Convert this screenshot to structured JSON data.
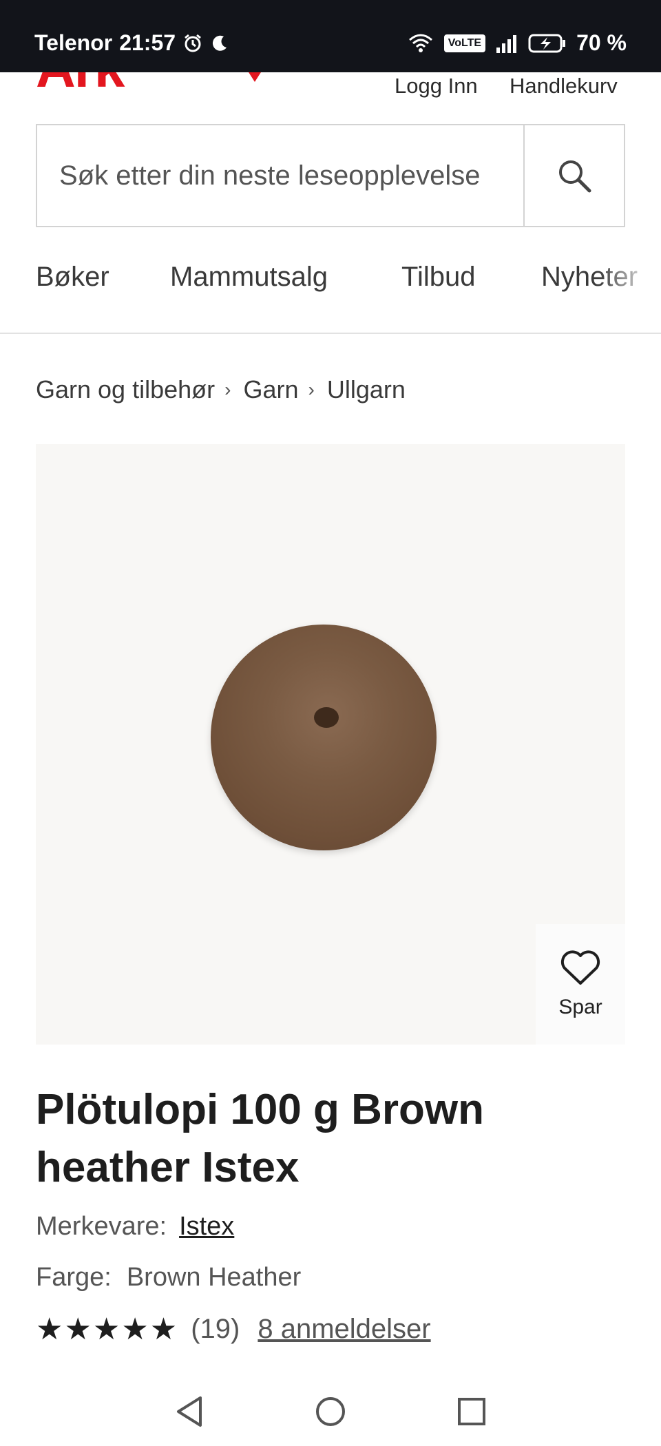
{
  "status_bar": {
    "carrier": "Telenor",
    "time": "21:57",
    "volte": "VoLTE",
    "battery": "70 %",
    "icons": [
      "alarm-icon",
      "moon-icon",
      "wifi-icon",
      "signal-icon",
      "battery-charging-icon"
    ]
  },
  "header": {
    "logo_text": "Ark",
    "login": "Logg Inn",
    "cart": "Handlekurv",
    "brand_color": "#e3161f"
  },
  "search": {
    "placeholder": "Søk etter din neste leseopplevelse",
    "icon": "search-icon"
  },
  "nav": {
    "items": [
      {
        "label": "Bøker"
      },
      {
        "label": "Mammutsalg"
      },
      {
        "label": "Tilbud"
      },
      {
        "label": "Nyheter"
      }
    ]
  },
  "breadcrumb": {
    "items": [
      "Garn og tilbehør",
      "Garn",
      "Ullgarn"
    ]
  },
  "product": {
    "save_label": "Spar",
    "title": "Plötulopi 100 g Brown heather Istex",
    "brand_label": "Merkevare:",
    "brand_value": "Istex",
    "color_label": "Farge:",
    "color_value": "Brown Heather",
    "stars": "★★★★★",
    "rating_value": 5,
    "rating_count": "(19)",
    "reviews_link": "8 anmeldelser",
    "yarn_color": "#7a5b43"
  },
  "android_nav": {
    "icons": [
      "back-icon",
      "home-icon",
      "recents-icon"
    ]
  }
}
